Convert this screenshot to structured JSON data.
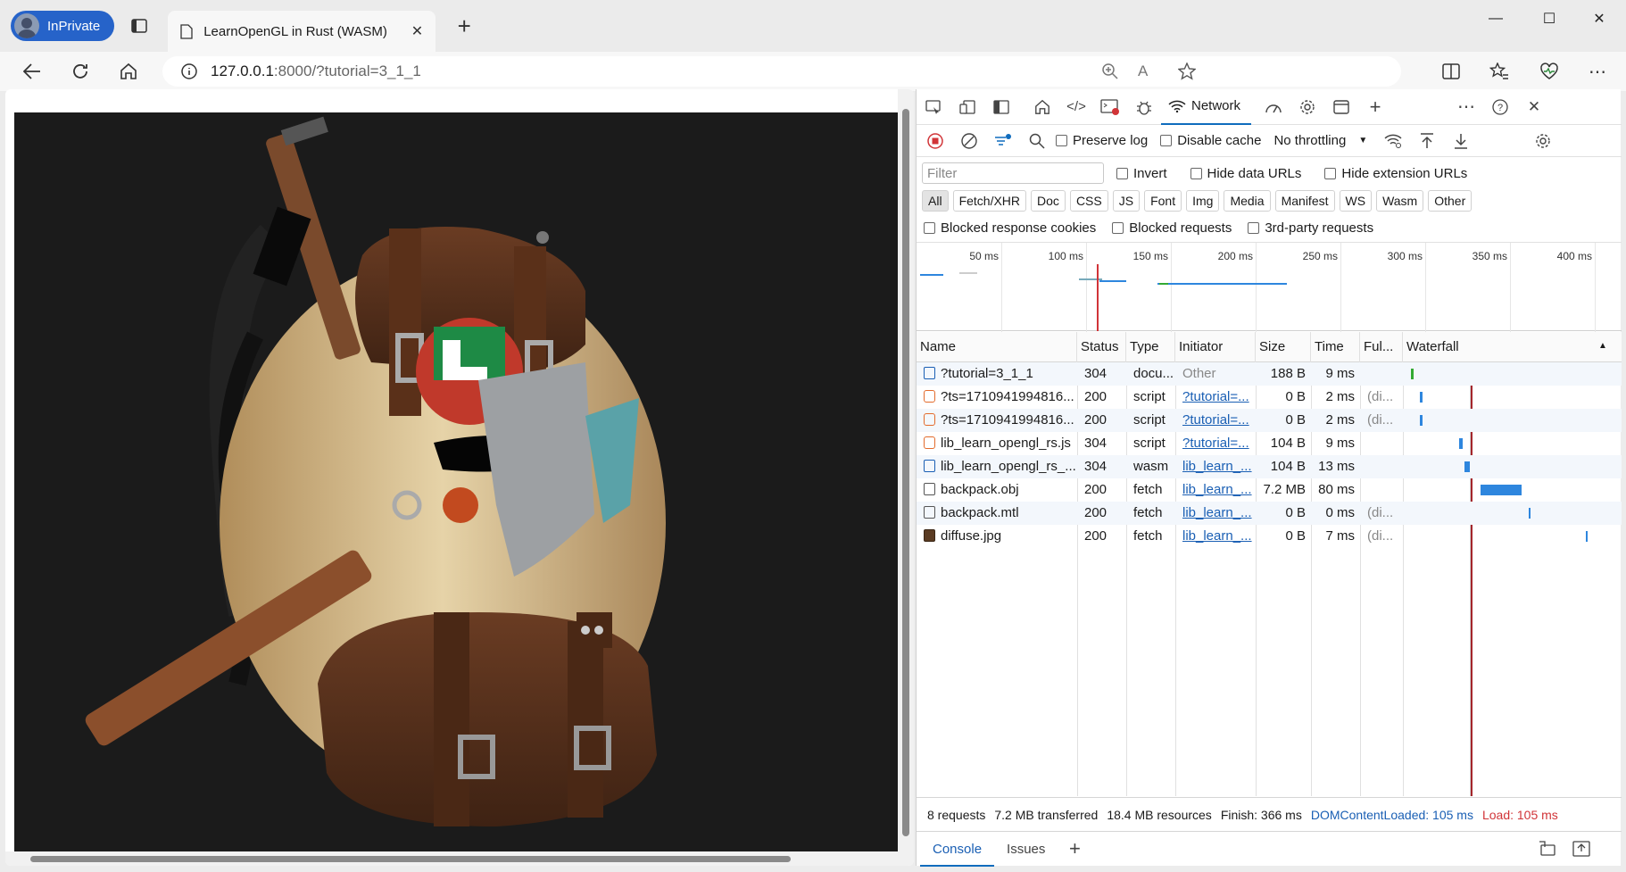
{
  "browser": {
    "inprivate_label": "InPrivate",
    "tab_title": "LearnOpenGL in Rust (WASM)",
    "url_host": "127.0.0.1",
    "url_rest": ":8000/?tutorial=3_1_1"
  },
  "devtools": {
    "active_tab": "Network",
    "preserve_log": "Preserve log",
    "disable_cache": "Disable cache",
    "throttling": "No throttling",
    "filter_placeholder": "Filter",
    "invert": "Invert",
    "hide_data_urls": "Hide data URLs",
    "hide_extension_urls": "Hide extension URLs",
    "type_filters": [
      "All",
      "Fetch/XHR",
      "Doc",
      "CSS",
      "JS",
      "Font",
      "Img",
      "Media",
      "Manifest",
      "WS",
      "Wasm",
      "Other"
    ],
    "blocked_cookies": "Blocked response cookies",
    "blocked_requests": "Blocked requests",
    "third_party": "3rd-party requests",
    "overview_ticks": [
      "50 ms",
      "100 ms",
      "150 ms",
      "200 ms",
      "250 ms",
      "300 ms",
      "350 ms",
      "400 ms"
    ],
    "columns": [
      "Name",
      "Status",
      "Type",
      "Initiator",
      "Size",
      "Time",
      "Ful...",
      "Waterfall"
    ],
    "rows": [
      {
        "name": "?tutorial=3_1_1",
        "status": "304",
        "type": "docu...",
        "initiator": "Other",
        "size": "188 B",
        "time": "9 ms",
        "ful": ""
      },
      {
        "name": "?ts=1710941994816...",
        "status": "200",
        "type": "script",
        "initiator": "?tutorial=...",
        "size": "0 B",
        "time": "2 ms",
        "ful": "(di..."
      },
      {
        "name": "?ts=1710941994816...",
        "status": "200",
        "type": "script",
        "initiator": "?tutorial=...",
        "size": "0 B",
        "time": "2 ms",
        "ful": "(di..."
      },
      {
        "name": "lib_learn_opengl_rs.js",
        "status": "304",
        "type": "script",
        "initiator": "?tutorial=...",
        "size": "104 B",
        "time": "9 ms",
        "ful": ""
      },
      {
        "name": "lib_learn_opengl_rs_...",
        "status": "304",
        "type": "wasm",
        "initiator": "lib_learn_...",
        "size": "104 B",
        "time": "13 ms",
        "ful": ""
      },
      {
        "name": "backpack.obj",
        "status": "200",
        "type": "fetch",
        "initiator": "lib_learn_...",
        "size": "7.2 MB",
        "time": "80 ms",
        "ful": ""
      },
      {
        "name": "backpack.mtl",
        "status": "200",
        "type": "fetch",
        "initiator": "lib_learn_...",
        "size": "0 B",
        "time": "0 ms",
        "ful": "(di..."
      },
      {
        "name": "diffuse.jpg",
        "status": "200",
        "type": "fetch",
        "initiator": "lib_learn_...",
        "size": "0 B",
        "time": "7 ms",
        "ful": "(di..."
      }
    ],
    "summary": {
      "requests": "8 requests",
      "transferred": "7.2 MB transferred",
      "resources": "18.4 MB resources",
      "finish": "Finish: 366 ms",
      "dcl": "DOMContentLoaded: 105 ms",
      "load": "Load: 105 ms"
    },
    "drawer_tabs": [
      "Console",
      "Issues"
    ]
  },
  "colors": {
    "accent": "#0f6cbd",
    "link": "#1a5fb4",
    "dcl": "#1a5fb4",
    "load": "#d13438",
    "inprivate": "#2663c9"
  }
}
